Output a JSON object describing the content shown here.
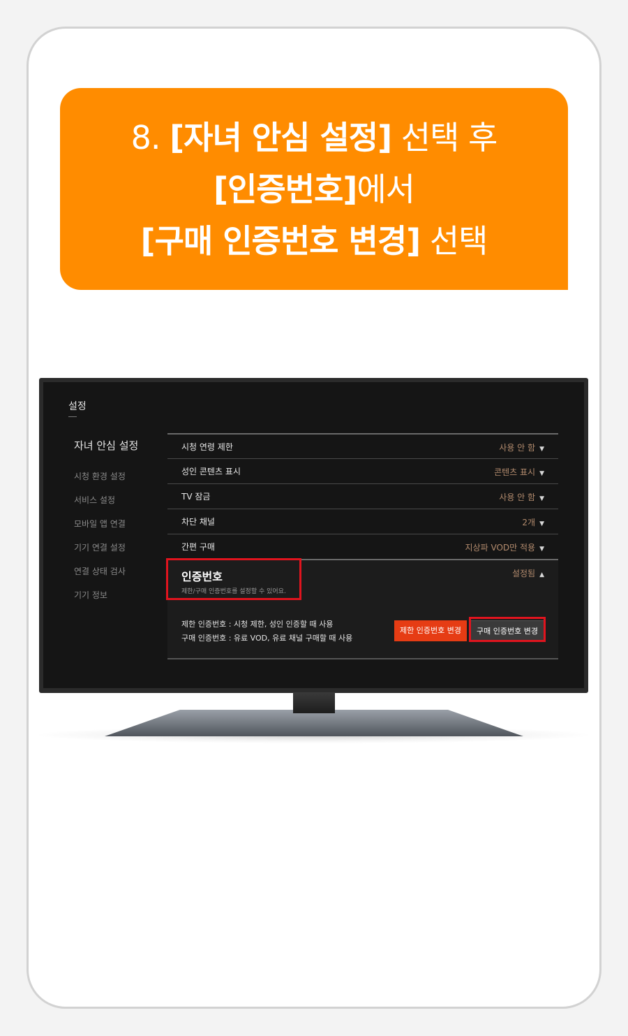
{
  "banner": {
    "line1_num": "8.",
    "line1_bold": "[자녀 안심 설정]",
    "line1_rest": "선택 후",
    "line2_bold": "[인증번호]",
    "line2_rest": "에서",
    "line3_bold": "[구매 인증번호 변경]",
    "line3_rest": "선택"
  },
  "screen": {
    "title": "설정",
    "sidebar": [
      {
        "label": "자녀 안심 설정",
        "active": true
      },
      {
        "label": "시청 환경 설정"
      },
      {
        "label": "서비스 설정"
      },
      {
        "label": "모바일 앱 연결"
      },
      {
        "label": "기기 연결 설정"
      },
      {
        "label": "연결 상태 검사"
      },
      {
        "label": "기기 정보"
      }
    ],
    "rows": [
      {
        "label": "시청 연령 제한",
        "value": "사용 안 함"
      },
      {
        "label": "성인 콘텐츠 표시",
        "value": "콘텐츠 표시"
      },
      {
        "label": "TV 잠금",
        "value": "사용 안 함"
      },
      {
        "label": "차단 채널",
        "value": "2개"
      },
      {
        "label": "간편 구매",
        "value": "지상파 VOD만 적용"
      }
    ],
    "auth": {
      "title": "인증번호",
      "subtitle": "제한/구매 인증번호를 설정할 수 있어요.",
      "status": "설정됨",
      "desc_restrict": "제한 인증번호 :   시청 제한, 성인 인증할 때 사용",
      "desc_purchase": "구매 인증번호 :   유료 VOD, 유료 채널 구매할 때 사용",
      "btn_restrict": "제한 인증번호 변경",
      "btn_purchase": "구매 인증번호 변경"
    }
  },
  "colors": {
    "banner": "#ff8c00",
    "highlight": "#e0141e",
    "restrict_button": "#e63c14",
    "value_text": "#b48c6e"
  }
}
